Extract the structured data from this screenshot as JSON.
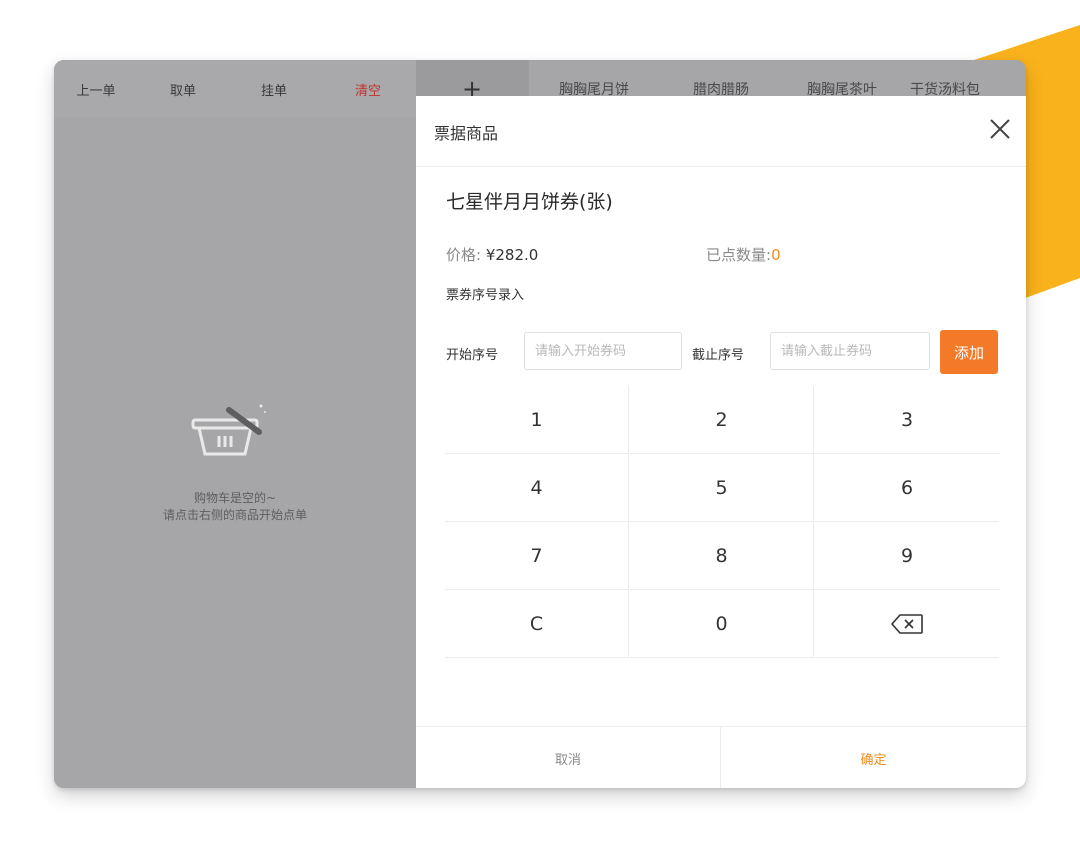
{
  "colors": {
    "accent_orange": "#f47a2a",
    "accent_yellow": "#f9b21b",
    "clear_red": "#c0322a",
    "overlay_gray": "#a6a6a8"
  },
  "toolbar": {
    "prev_order": "上一单",
    "take_order": "取单",
    "hold_order": "挂单",
    "clear": "清空",
    "add_symbol": "+"
  },
  "categories": [
    "胸胸尾月饼",
    "腊肉腊肠",
    "胸胸尾茶叶",
    "干货汤料包"
  ],
  "cart": {
    "empty_line1": "购物车是空的~",
    "empty_line2": "请点击右侧的商品开始点单"
  },
  "modal": {
    "title": "票据商品",
    "product_name": "七星伴月月饼券(张)",
    "price_label": "价格:",
    "price_value": "¥282.0",
    "qty_label": "已点数量:",
    "qty_value": "0",
    "serial_section": "票券序号录入",
    "start_label": "开始序号",
    "start_placeholder": "请输入开始券码",
    "end_label": "截止序号",
    "end_placeholder": "请输入截止券码",
    "add_button": "添加",
    "keys": [
      "1",
      "2",
      "3",
      "4",
      "5",
      "6",
      "7",
      "8",
      "9",
      "C",
      "0",
      "backspace-icon"
    ],
    "cancel": "取消",
    "confirm": "确定"
  }
}
